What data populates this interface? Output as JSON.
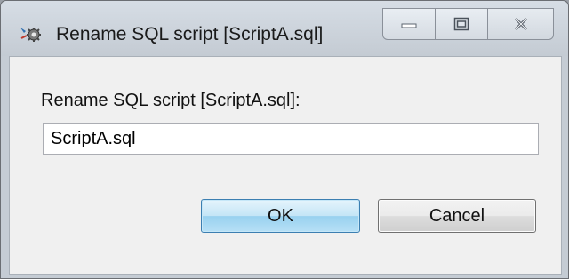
{
  "window": {
    "title": "Rename SQL script [ScriptA.sql]",
    "icon": "gear-tool-icon"
  },
  "caption_buttons": {
    "minimize_icon": "minimize-icon",
    "maximize_icon": "maximize-icon",
    "close_icon": "close-icon"
  },
  "dialog": {
    "prompt": "Rename SQL script [ScriptA.sql]:",
    "input_value": "ScriptA.sql",
    "ok_label": "OK",
    "cancel_label": "Cancel"
  },
  "colors": {
    "default_button_border": "#3c7fb1",
    "window_frame": "#c5ccd4"
  }
}
